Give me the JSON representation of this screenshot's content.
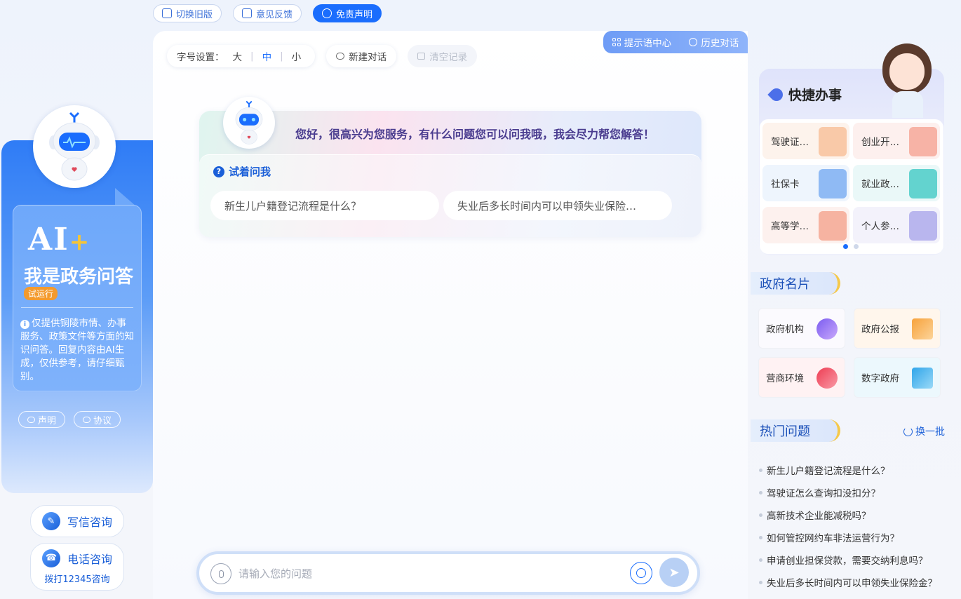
{
  "top_bar": {
    "buttons": [
      {
        "label": "切换旧版",
        "icon": "switch-icon"
      },
      {
        "label": "意见反馈",
        "icon": "edit-icon"
      },
      {
        "label": "免责声明",
        "icon": "chat-icon",
        "active": true
      }
    ]
  },
  "left_panel": {
    "brand": "AI",
    "brand_plus": "+",
    "slogan": "我是政务问答",
    "badge": "试运行",
    "disclaimer": "仅提供铜陵市情、办事服务、政策文件等方面的知识问答。回复内容由AI生成，仅供参考，请仔细甄别。",
    "links": [
      {
        "label": "声明"
      },
      {
        "label": "协议"
      }
    ],
    "write_consult": "写信咨询",
    "phone_consult": "电话咨询",
    "phone_sub": "拨打12345咨询"
  },
  "toolbar": {
    "font_size_label": "字号设置：",
    "font_sizes": [
      "大",
      "中",
      "小"
    ],
    "active_font_size": "中",
    "new_chat": "新建对话",
    "clear_records": "清空记录"
  },
  "tabs": {
    "prompt_center": "提示语中心",
    "history": "历史对话"
  },
  "chat": {
    "greeting": "您好，很高兴为您服务，有什么问题您可以问我哦，我会尽力帮您解答！",
    "try_title": "试着问我",
    "suggestions": [
      "新生儿户籍登记流程是什么？",
      "失业后多长时间内可以申领失业保险…"
    ]
  },
  "input": {
    "placeholder": "请输入您的问题"
  },
  "quick": {
    "title": "快捷办事",
    "items": [
      {
        "label": "驾驶证…",
        "icon": "books-icon"
      },
      {
        "label": "创业开…",
        "icon": "building-icon"
      },
      {
        "label": "社保卡",
        "icon": "card-icon"
      },
      {
        "label": "就业政…",
        "icon": "doc-icon"
      },
      {
        "label": "高等学…",
        "icon": "books-icon"
      },
      {
        "label": "个人参…",
        "icon": "file-icon"
      }
    ]
  },
  "gov": {
    "title": "政府名片",
    "items": [
      {
        "label": "政府机构",
        "icon": "org-icon"
      },
      {
        "label": "政府公报",
        "icon": "bulletin-icon"
      },
      {
        "label": "营商环境",
        "icon": "business-icon"
      },
      {
        "label": "数字政府",
        "icon": "digital-icon"
      }
    ]
  },
  "hot": {
    "title": "热门问题",
    "refresh": "换一批",
    "items": [
      "新生儿户籍登记流程是什么？",
      "驾驶证怎么查询扣没扣分？",
      "高新技术企业能减税吗？",
      "如何管控网约车非法运营行为？",
      "申请创业担保贷款，需要交纳利息吗？",
      "失业后多长时间内可以申领失业保险金？"
    ]
  },
  "colors": {
    "accent": "#1a6dfd",
    "brand_blue": "#2f7cf6",
    "badge_orange": "#f39a2d"
  }
}
